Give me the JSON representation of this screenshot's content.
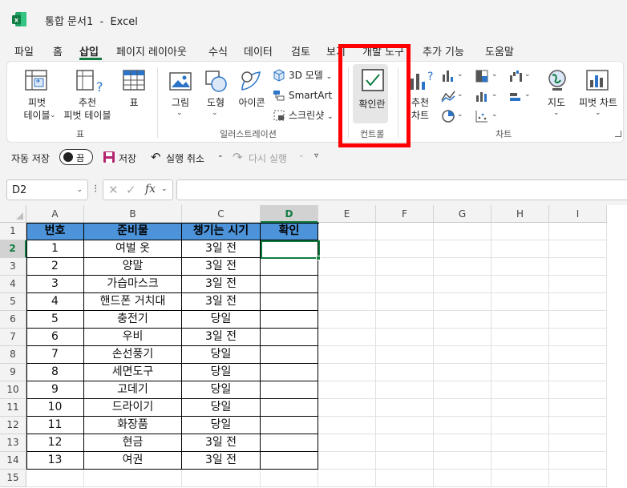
{
  "window": {
    "title": "통합 문서1  -  Excel",
    "accent_color": "#107c41",
    "header_fill_color": "#4d93d9",
    "highlight_color": "#ff0000"
  },
  "menu": {
    "tabs": [
      {
        "label": "파일"
      },
      {
        "label": "홈"
      },
      {
        "label": "삽입"
      },
      {
        "label": "페이지 레이아웃"
      },
      {
        "label": "수식"
      },
      {
        "label": "데이터"
      },
      {
        "label": "검토"
      },
      {
        "label": "보기"
      },
      {
        "label": "개발 도구"
      },
      {
        "label": "추가 기능"
      },
      {
        "label": "도움말"
      }
    ],
    "active": "삽입"
  },
  "ribbon": {
    "tables": {
      "pivot_table": "피벗\n테이블",
      "recommended_pivot": "추천\n피벗 테이블",
      "table": "표",
      "group_label": "표"
    },
    "illustrations": {
      "picture": "그림",
      "shapes": "도형",
      "icons": "아이콘",
      "model_3d": "3D 모델",
      "smartart": "SmartArt",
      "screenshot": "스크린샷",
      "group_label": "일러스트레이션"
    },
    "controls": {
      "checkbox": "확인란",
      "group_label": "컨트롤"
    },
    "charts": {
      "recommended_charts": "추천\n차트",
      "maps": "지도",
      "pivot_chart": "피벗 차트",
      "group_label": "차트"
    }
  },
  "qat": {
    "autosave_label": "자동 저장",
    "autosave_state": "끔",
    "save_label": "저장",
    "undo_label": "실행 취소",
    "redo_label": "다시 실행"
  },
  "formula_bar": {
    "name_box": "D2",
    "fx_label": "fx",
    "value": ""
  },
  "sheet": {
    "columns": [
      "A",
      "B",
      "C",
      "D",
      "E",
      "F",
      "G",
      "H",
      "I"
    ],
    "rows": [
      "1",
      "2",
      "3",
      "4",
      "5",
      "6",
      "7",
      "8",
      "9",
      "10",
      "11",
      "12",
      "13",
      "14",
      "15"
    ],
    "selected_cell": "D2",
    "headers": [
      "번호",
      "준비물",
      "챙기는 시기",
      "확인"
    ],
    "data": [
      [
        "1",
        "여벌 옷",
        "3일 전",
        ""
      ],
      [
        "2",
        "양말",
        "3일 전",
        ""
      ],
      [
        "3",
        "가습마스크",
        "3일 전",
        ""
      ],
      [
        "4",
        "핸드폰 거치대",
        "3일 전",
        ""
      ],
      [
        "5",
        "충전기",
        "당일",
        ""
      ],
      [
        "6",
        "우비",
        "3일 전",
        ""
      ],
      [
        "7",
        "손선풍기",
        "당일",
        ""
      ],
      [
        "8",
        "세면도구",
        "당일",
        ""
      ],
      [
        "9",
        "고데기",
        "당일",
        ""
      ],
      [
        "10",
        "드라이기",
        "당일",
        ""
      ],
      [
        "11",
        "화장품",
        "당일",
        ""
      ],
      [
        "12",
        "현금",
        "3일 전",
        ""
      ],
      [
        "13",
        "여권",
        "3일 전",
        ""
      ]
    ]
  }
}
